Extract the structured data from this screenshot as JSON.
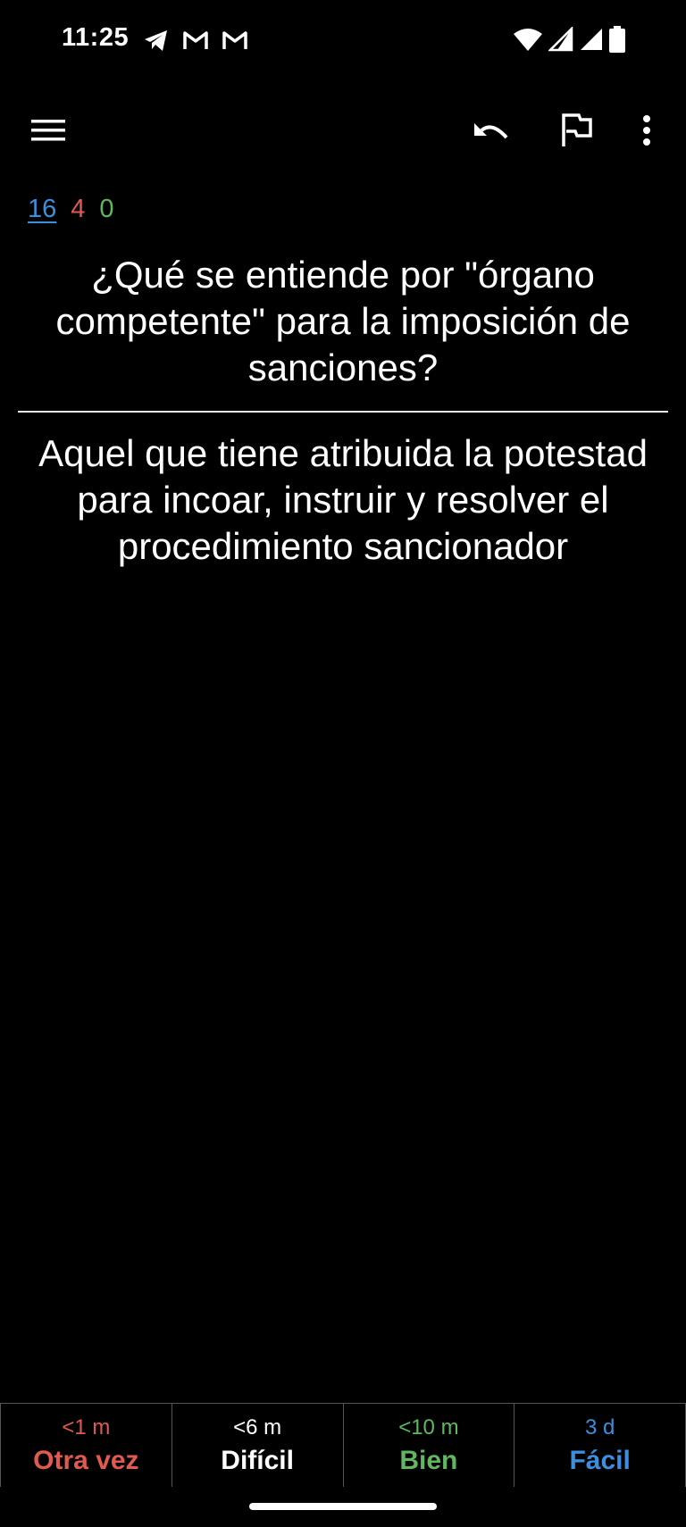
{
  "status_bar": {
    "time": "11:25",
    "left_icons": [
      "telegram-icon",
      "gmail-icon",
      "gmail-icon"
    ],
    "right_icons": [
      "wifi-icon",
      "cell-signal-icon",
      "cell-signal-icon",
      "battery-icon"
    ]
  },
  "toolbar": {
    "icons": [
      "menu-icon",
      "undo-icon",
      "flag-icon",
      "more-vert-icon"
    ]
  },
  "counts": {
    "new": "16",
    "learning": "4",
    "review": "0"
  },
  "card": {
    "question": "¿Qué se entiende por \"órgano competente\" para la imposición de sanciones?",
    "answer": "Aquel que tiene atribuida la potestad para incoar, instruir y resolver el procedimiento sancionador"
  },
  "answer_buttons": [
    {
      "time": "<1 m",
      "label": "Otra vez",
      "color": "#e05a4f"
    },
    {
      "time": "<6 m",
      "label": "Difícil",
      "color": "#ffffff"
    },
    {
      "time": "<10 m",
      "label": "Bien",
      "color": "#5fb85f"
    },
    {
      "time": "3 d",
      "label": "Fácil",
      "color": "#3c8fe0"
    }
  ],
  "colors": {
    "background": "#000000",
    "new_count": "#3c8fe0",
    "learning_count": "#e05a4f",
    "review_count": "#5fb85f"
  }
}
